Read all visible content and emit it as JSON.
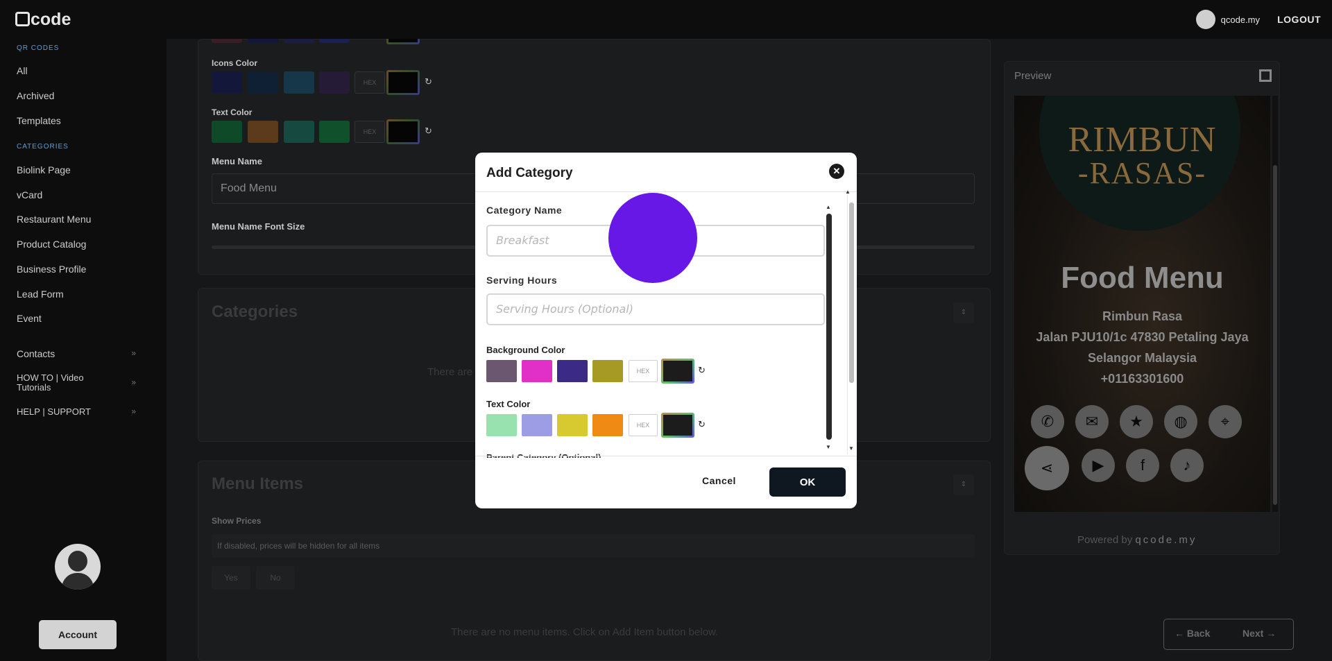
{
  "topbar": {
    "logo": "code",
    "user": "qcode.my",
    "logout": "LOGOUT"
  },
  "sidebar": {
    "sections": [
      {
        "head": "QR CODES",
        "items": [
          "All",
          "Archived",
          "Templates"
        ]
      },
      {
        "head": "CATEGORIES",
        "items": [
          "Biolink Page",
          "vCard",
          "Restaurant Menu",
          "Product Catalog",
          "Business Profile",
          "Lead Form",
          "Event"
        ]
      }
    ],
    "expandables": [
      "Contacts",
      "HOW TO | Video Tutorials",
      "HELP | SUPPORT"
    ],
    "account_label": "Account"
  },
  "editor": {
    "icons_color_label": "Icons Color",
    "text_color_label": "Text Color",
    "menu_name_label": "Menu Name",
    "menu_name_value": "Food Menu",
    "menu_name_font_size_label": "Menu Name Font Size",
    "categories_title": "Categories",
    "categories_empty": "There are",
    "menu_items_title": "Menu Items",
    "show_prices_label": "Show Prices",
    "show_prices_hint": "If disabled, prices will be hidden for all items",
    "yes": "Yes",
    "no": "No",
    "menu_items_empty": "There are no menu items. Click on Add Item button below.",
    "hex": "HEX",
    "icons_swatches": [
      "#13183a",
      "#102034",
      "#16374a",
      "#251b36"
    ],
    "text_swatches": [
      "#0f4a28",
      "#5c3a1c",
      "#164a40",
      "#10502a"
    ]
  },
  "preview": {
    "label": "Preview",
    "brand_top": "RIMBUN",
    "brand_bottom": "-RASAS-",
    "title": "Food Menu",
    "lines": [
      "Rimbun Rasa",
      "Jalan PJU10/1c 47830 Petaling Jaya",
      "Selangor Malaysia",
      "+01163301600"
    ],
    "icons_row1": [
      "phone-icon",
      "email-icon",
      "star-icon",
      "globe-icon",
      "location-icon"
    ],
    "icons_row2": [
      "share-icon",
      "youtube-icon",
      "facebook-icon",
      "tiktok-icon"
    ],
    "powered_by": "Powered by",
    "powered_brand": "qcode.my"
  },
  "nav": {
    "back": "Back",
    "next": "Next"
  },
  "modal": {
    "title": "Add Category",
    "category_name_label": "Category Name",
    "category_name_placeholder": "Breakfast",
    "serving_hours_label": "Serving Hours",
    "serving_hours_placeholder": "Serving Hours (Optional)",
    "background_color_label": "Background Color",
    "text_color_label": "Text Color",
    "parent_category_label": "Parent Category (Optional)",
    "hex": "HEX",
    "background_swatches": [
      "#6b5870",
      "#e030c8",
      "#3b2a86",
      "#a69a24"
    ],
    "text_swatches": [
      "#98e2b0",
      "#9d9de6",
      "#d6ca30",
      "#ef8a14"
    ],
    "cancel": "Cancel",
    "ok": "OK"
  }
}
